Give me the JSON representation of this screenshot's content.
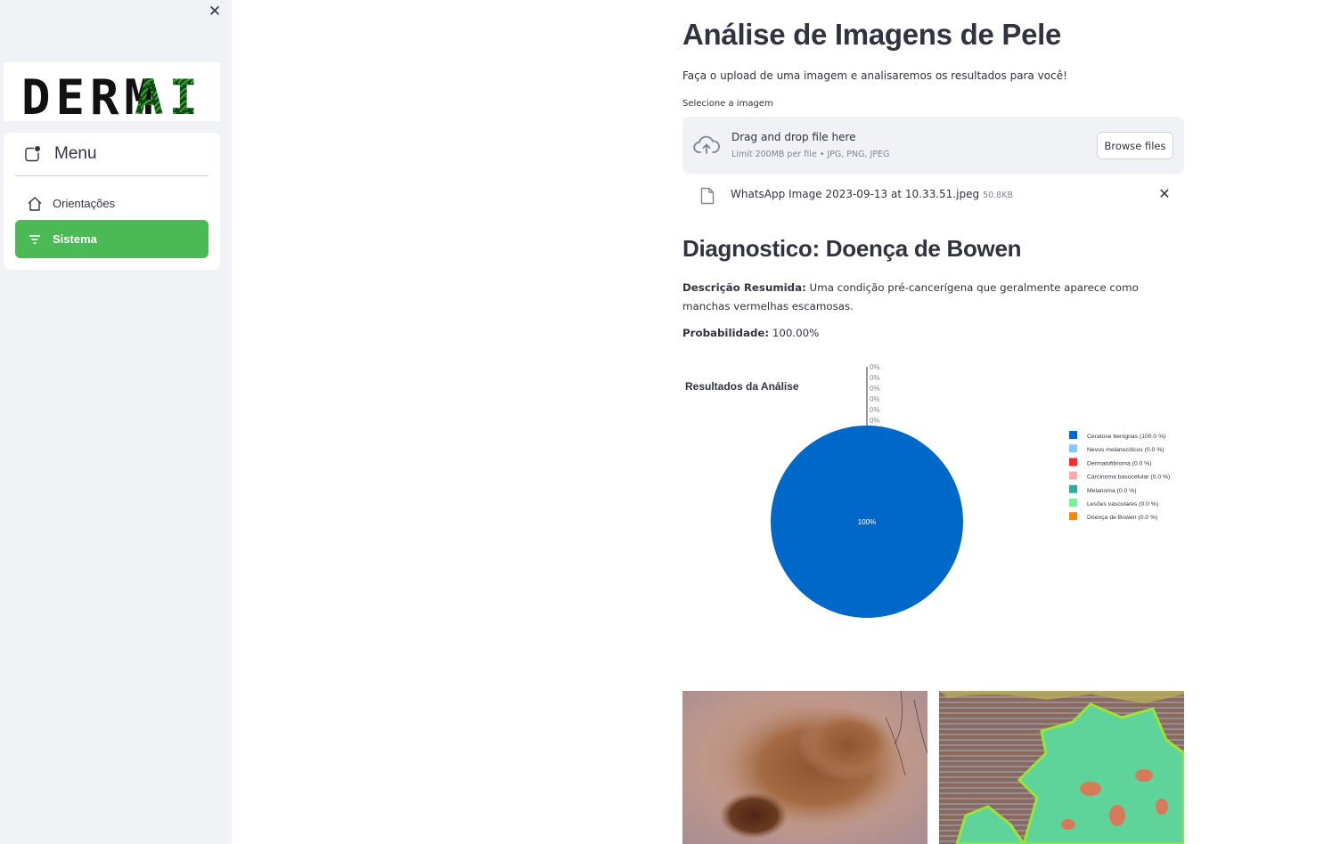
{
  "sidebar": {
    "close_icon": "close-icon",
    "logo": {
      "text_plain": "DERM",
      "text_accent": "AI"
    },
    "menu": {
      "title": "Menu",
      "items": [
        {
          "label": "Orientações",
          "icon": "home-icon",
          "active": false
        },
        {
          "label": "Sistema",
          "icon": "filter-lines-icon",
          "active": true
        }
      ]
    },
    "colors": {
      "active_bg": "#4cba54",
      "bg": "#f0f2f6"
    }
  },
  "main": {
    "title": "Análise de Imagens de Pele",
    "subtitle": "Faça o upload de uma imagem e analisaremos os resultados para você!",
    "uploader": {
      "label": "Selecione a imagem",
      "drag_text": "Drag and drop file here",
      "limit_text": "Limit 200MB per file • JPG, PNG, JPEG",
      "browse_label": "Browse files"
    },
    "file": {
      "name": "WhatsApp Image 2023-09-13 at 10.33.51.jpeg",
      "size": "50.8KB"
    },
    "diagnosis": {
      "title": "Diagnostico: Doença de Bowen",
      "desc_label": "Descrição Resumida:",
      "desc_text": " Uma condição pré-cancerígena que geralmente aparece como manchas vermelhas escamosas.",
      "prob_label": "Probabilidade:",
      "prob_value": " 100.00%"
    }
  },
  "chart_data": {
    "type": "pie",
    "title": "Resultados da Análise",
    "labels": [
      "Ceratose benignas (100.0 %)",
      "Nevos melanocíticos (0.0 %)",
      "Dermatofibroma (0.0 %)",
      "Carcinoma basocelular (0.0 %)",
      "Melanoma (0.0 %)",
      "Lesões vasculares (0.0 %)",
      "Doença de Bowen (0.0 %)"
    ],
    "values": [
      100.0,
      0.0,
      0.0,
      0.0,
      0.0,
      0.0,
      0.0
    ],
    "colors": [
      "#0068c9",
      "#83c9ff",
      "#ff2b2b",
      "#ffabab",
      "#29b09d",
      "#7defa1",
      "#ff8700"
    ],
    "slice_labels": [
      "100%",
      "0%",
      "0%",
      "0%",
      "0%",
      "0%",
      "0%"
    ],
    "legend_position": "right"
  }
}
